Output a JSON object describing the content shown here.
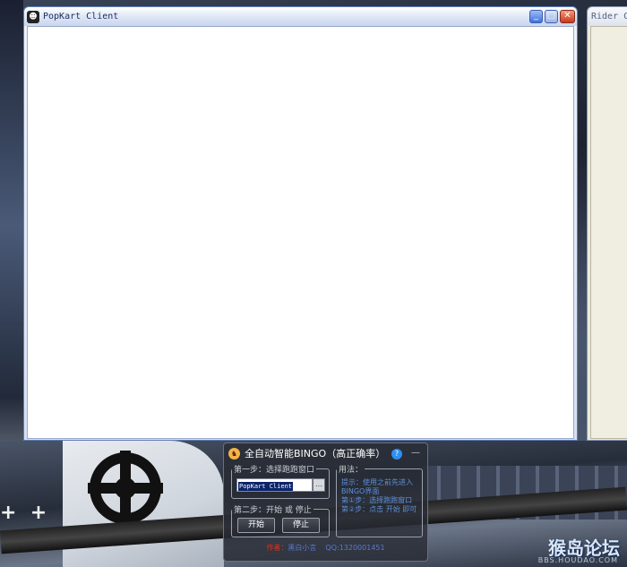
{
  "main_window": {
    "title": "PopKart Client",
    "icon": "popkart-icon",
    "controls": {
      "minimize": "minimize-icon",
      "maximize": "maximize-icon",
      "close": "close-icon"
    }
  },
  "side_window": {
    "title": "Rider C"
  },
  "tool": {
    "title": "全自动智能BINGO（高正确率）",
    "step1_legend": "第一步：选择跑跑窗口",
    "window_select_value": "PopKart Client",
    "step2_legend": "第二步：开始 或 停止",
    "start_label": "开始",
    "stop_label": "停止",
    "usage_legend": "用法：",
    "usage_lines": [
      "提示：使用之前先进入BINGO界面",
      "第①步：选择跑跑窗口",
      "第②步：点击 开始 即可"
    ],
    "author_label": "作者：",
    "author_name": "黑白小言",
    "qq": "QQ:1320001451"
  },
  "watermark": {
    "text": "猴岛论坛",
    "sub": "BBS.HOUDAO.COM"
  },
  "colors": {
    "xp_title_blue": "#1b2f63",
    "close_red": "#c8391a",
    "tool_bg": "#2b2f36",
    "usage_text": "#5d8fd8",
    "author_red": "#e03020"
  }
}
